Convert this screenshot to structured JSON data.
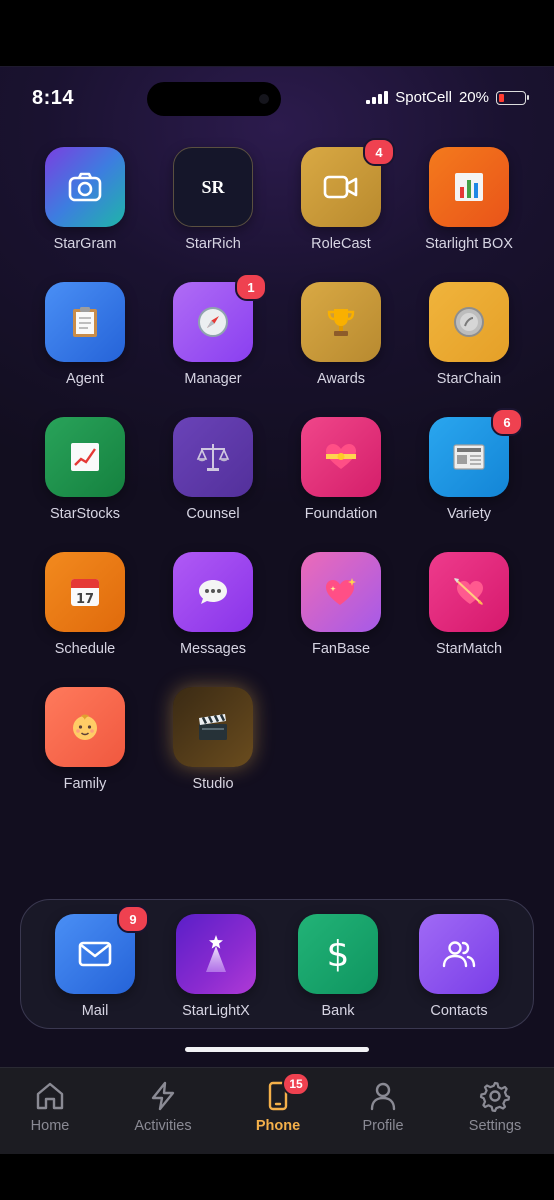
{
  "status_bar": {
    "time": "8:14",
    "carrier": "SpotCell",
    "battery_percent": "20%",
    "battery_level": 0.2
  },
  "apps": [
    {
      "label": "StarGram",
      "icon": "camera-icon",
      "badge": ""
    },
    {
      "label": "StarRich",
      "icon": "SR",
      "badge": ""
    },
    {
      "label": "RoleCast",
      "icon": "video-camera-icon",
      "badge": "4"
    },
    {
      "label": "Starlight BOX",
      "icon": "bar-chart-icon",
      "badge": ""
    },
    {
      "label": "Agent",
      "icon": "clipboard-icon",
      "badge": ""
    },
    {
      "label": "Manager",
      "icon": "compass-icon",
      "badge": "1"
    },
    {
      "label": "Awards",
      "icon": "trophy-icon",
      "badge": ""
    },
    {
      "label": "StarChain",
      "icon": "coin-icon",
      "badge": ""
    },
    {
      "label": "StarStocks",
      "icon": "chart-up-icon",
      "badge": ""
    },
    {
      "label": "Counsel",
      "icon": "scales-icon",
      "badge": ""
    },
    {
      "label": "Foundation",
      "icon": "heart-ribbon-icon",
      "badge": ""
    },
    {
      "label": "Variety",
      "icon": "newspaper-icon",
      "badge": "6"
    },
    {
      "label": "Schedule",
      "icon": "calendar-icon",
      "badge": ""
    },
    {
      "label": "Messages",
      "icon": "speech-bubble-icon",
      "badge": ""
    },
    {
      "label": "FanBase",
      "icon": "sparkling-heart-icon",
      "badge": ""
    },
    {
      "label": "StarMatch",
      "icon": "heart-arrow-icon",
      "badge": ""
    },
    {
      "label": "Family",
      "icon": "baby-icon",
      "badge": ""
    },
    {
      "label": "Studio",
      "icon": "clapper-board-icon",
      "badge": ""
    }
  ],
  "dock": [
    {
      "label": "Mail",
      "icon": "mail-icon",
      "badge": "9"
    },
    {
      "label": "StarLightX",
      "icon": "star-beam-icon",
      "badge": ""
    },
    {
      "label": "Bank",
      "icon": "dollar-icon",
      "badge": ""
    },
    {
      "label": "Contacts",
      "icon": "people-icon",
      "badge": ""
    }
  ],
  "tabs": [
    {
      "label": "Home",
      "icon": "home-icon",
      "badge": ""
    },
    {
      "label": "Activities",
      "icon": "lightning-icon",
      "badge": ""
    },
    {
      "label": "Phone",
      "icon": "phone-icon",
      "badge": "15",
      "active": true
    },
    {
      "label": "Profile",
      "icon": "person-icon",
      "badge": ""
    },
    {
      "label": "Settings",
      "icon": "gear-icon",
      "badge": ""
    }
  ],
  "colors": {
    "active_tab": "#f4b04a",
    "badge": "#ef4150",
    "background": "#120e1f"
  }
}
